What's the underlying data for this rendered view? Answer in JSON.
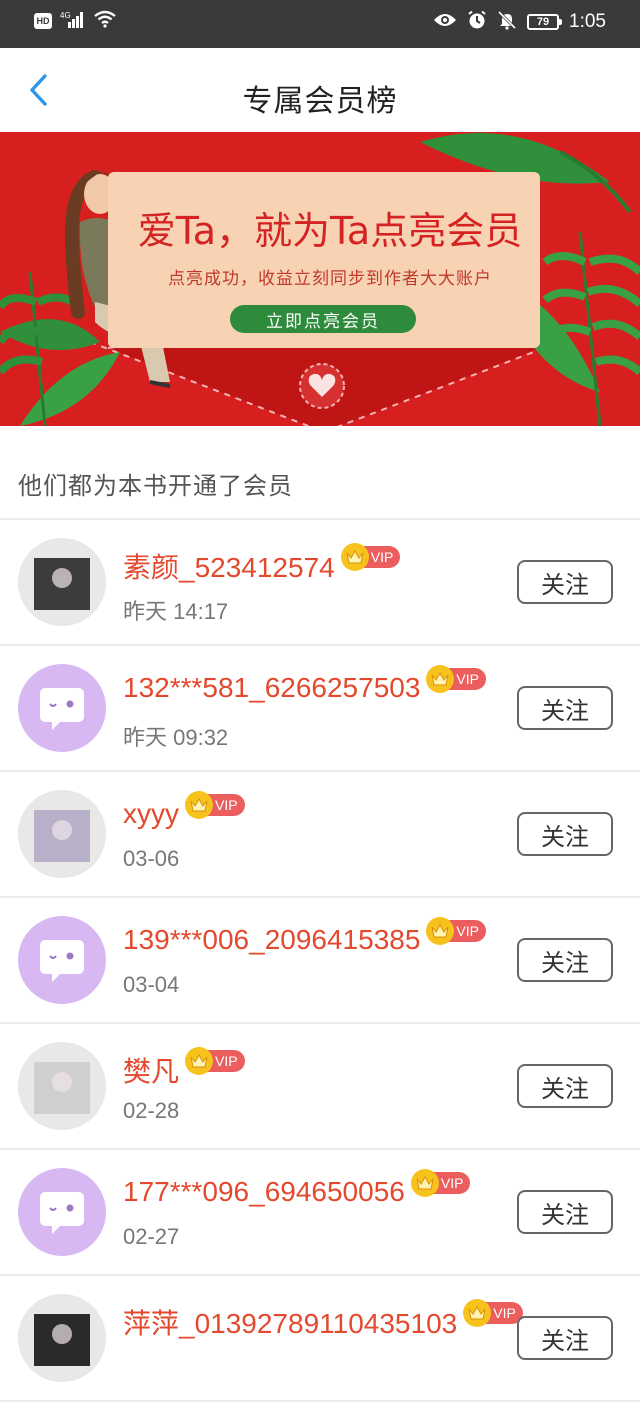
{
  "status_bar": {
    "hd": "HD",
    "network": "4G",
    "battery": "79",
    "time": "1:05"
  },
  "header": {
    "title": "专属会员榜"
  },
  "banner": {
    "title": "爱Ta，就为Ta点亮会员",
    "subtitle": "点亮成功，收益立刻同步到作者大大账户",
    "button": "立即点亮会员"
  },
  "section": {
    "title": "他们都为本书开通了会员"
  },
  "vip_label": "VIP",
  "follow_label": "关注",
  "members": [
    {
      "name": "素颜_523412574",
      "time": "昨天 14:17",
      "avatar": "photo"
    },
    {
      "name": "132***581_6266257503",
      "time": "昨天 09:32",
      "avatar": "default"
    },
    {
      "name": "xyyy",
      "time": "03-06",
      "avatar": "photo"
    },
    {
      "name": "139***006_2096415385",
      "time": "03-04",
      "avatar": "default"
    },
    {
      "name": "樊凡",
      "time": "02-28",
      "avatar": "photo"
    },
    {
      "name": "177***096_694650056",
      "time": "02-27",
      "avatar": "default"
    },
    {
      "name": "萍萍_01392789110435103",
      "time": "",
      "avatar": "photo"
    }
  ],
  "colors": {
    "name": "#e3492d",
    "vip": "#ec5d5d",
    "crown": "#f7c21b",
    "banner": "#d81f1f",
    "back_arrow": "#2f95e8"
  }
}
